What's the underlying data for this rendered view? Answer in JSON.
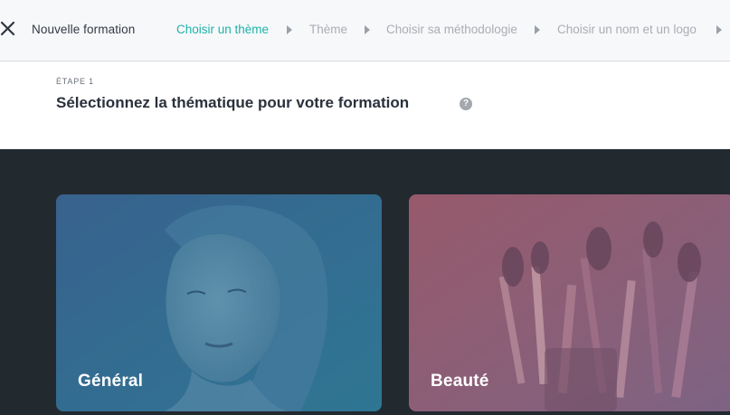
{
  "header": {
    "title": "Nouvelle formation",
    "steps": [
      {
        "label": "Choisir un thème",
        "active": true
      },
      {
        "label": "Thème",
        "active": false
      },
      {
        "label": "Choisir sa méthodologie",
        "active": false
      },
      {
        "label": "Choisir un nom et un logo",
        "active": false
      }
    ],
    "icons": {
      "close": "close-icon",
      "separator": "caret-right-icon"
    }
  },
  "main": {
    "step_label": "ÉTAPE 1",
    "heading": "Sélectionnez la thématique pour votre formation",
    "help_icon": "question-circle-icon",
    "help_glyph": "?"
  },
  "themes": [
    {
      "label": "Général",
      "overlay_color": "#2f6b8c"
    },
    {
      "label": "Beauté",
      "overlay_color": "#8a5a72"
    }
  ],
  "colors": {
    "accent": "#1fb2a8",
    "header_bg": "#f7f8fa",
    "dark_band": "#22292f",
    "inactive_step": "#a9adb4"
  }
}
